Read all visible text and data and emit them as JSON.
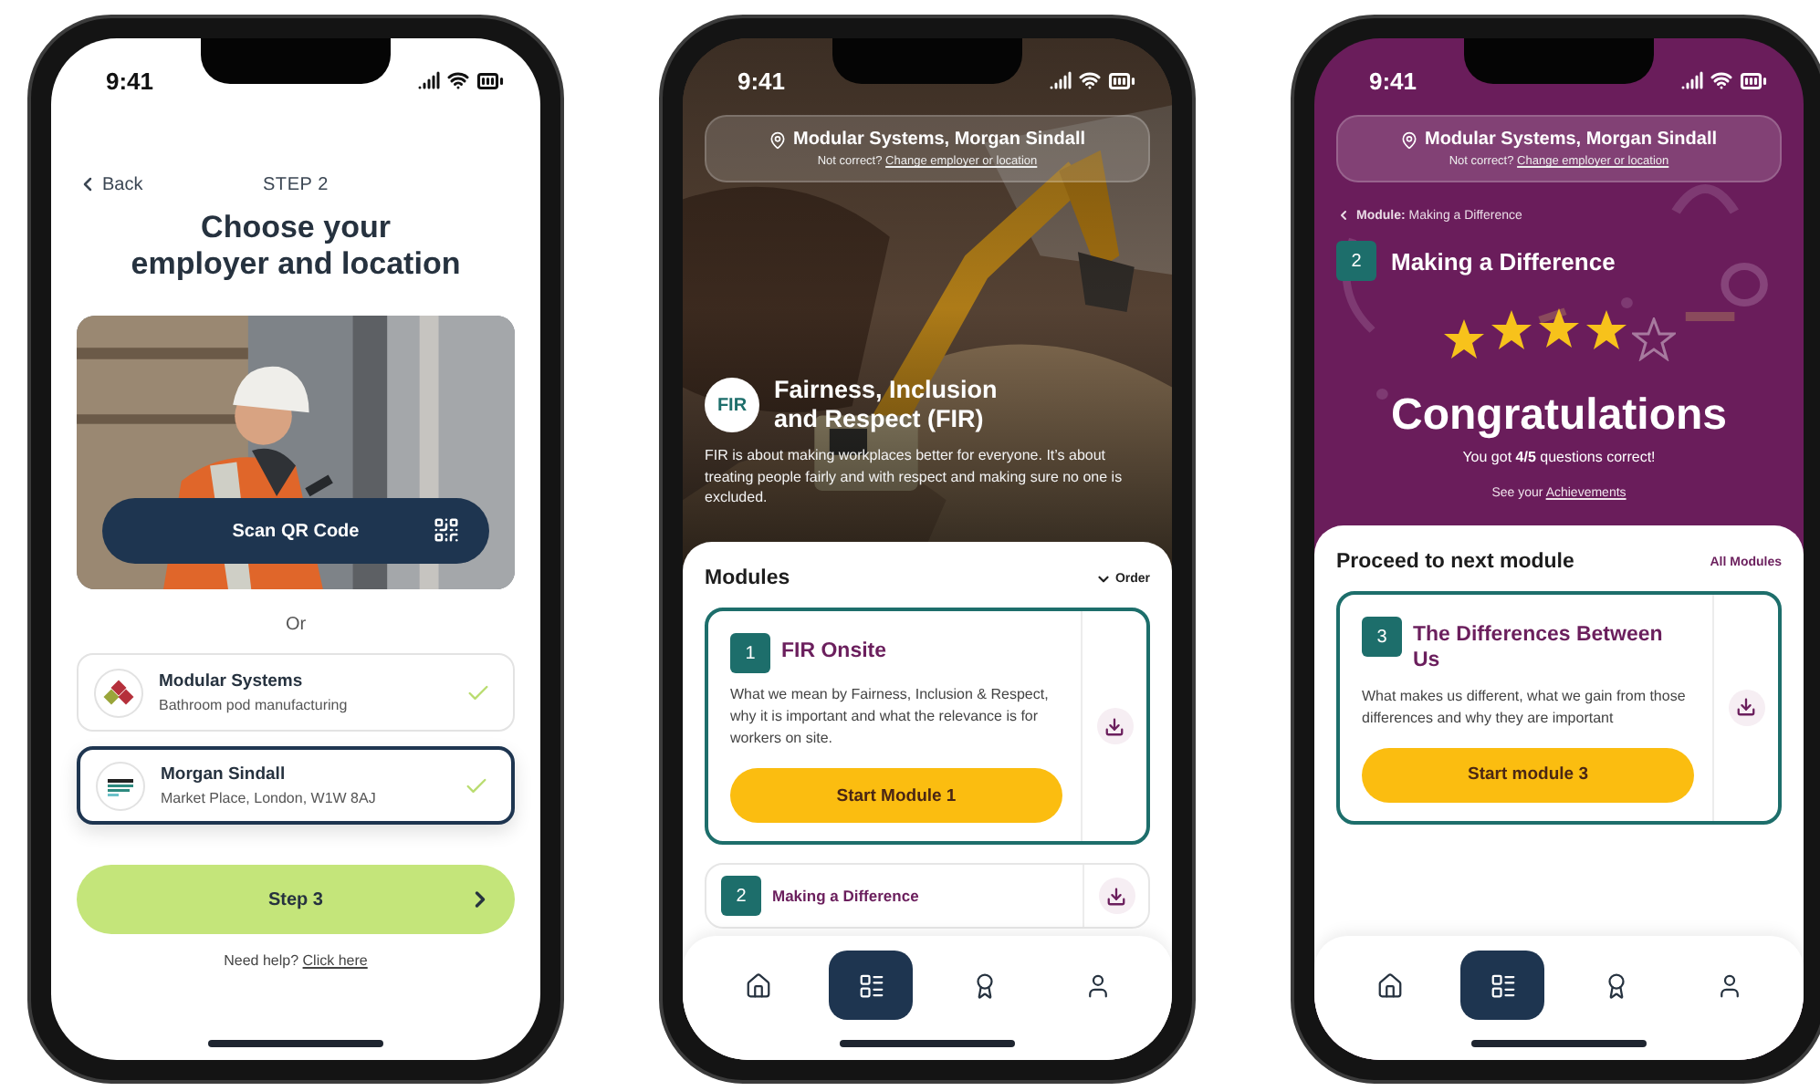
{
  "phones": [
    {
      "kind": "employer_select",
      "time": "9:41",
      "back": "Back",
      "step": "STEP 2",
      "title": "Choose your employer and location",
      "scan_button": "Scan QR Code",
      "divider": "Or",
      "employers": [
        {
          "kind": "modular",
          "name": "Modular Systems",
          "detail": "Bathroom pod manufacturing",
          "selected": false
        },
        {
          "kind": "morgan",
          "name": "Morgan Sindall",
          "detail": "Market Place, London, W1W 8AJ",
          "selected": true
        }
      ],
      "next_button": "Step 3",
      "help": "Need help?",
      "help_link": "Click here"
    },
    {
      "kind": "modules",
      "time": "9:41",
      "location": {
        "name": "Modular Systems, Morgan Sindall",
        "note": "Not correct?",
        "link": "Change employer or location"
      },
      "badge": "FIR",
      "heading": "Fairness, Inclusion and Respect (FIR)",
      "description": "FIR is about making workplaces better for everyone. It’s about treating people fairly and with respect and making sure no one is excluded.",
      "section_title": "Modules",
      "order": "Order",
      "modules": [
        {
          "number": "1",
          "title": "FIR Onsite",
          "description": "What we mean by Fairness, Inclusion & Respect, why it is important and what the relevance is for workers on site.",
          "button": "Start Module 1",
          "selected": true
        },
        {
          "number": "2",
          "title": "Making a Difference",
          "selected": false
        }
      ],
      "nav": [
        {
          "kind": "home",
          "selected": false
        },
        {
          "kind": "modules",
          "selected": true
        },
        {
          "kind": "achievements",
          "selected": false
        },
        {
          "kind": "profile",
          "selected": false
        }
      ]
    },
    {
      "kind": "results",
      "time": "9:41",
      "location": {
        "name": "Modular Systems, Morgan Sindall",
        "note": "Not correct?",
        "link": "Change employer or location"
      },
      "breadcrumb": "**Module:** Making a Difference",
      "module_number": "2",
      "module_title": "Making a Difference",
      "stars": 4,
      "headline": "Congratulations",
      "score": "You got **4/5** questions correct!",
      "achievements_text": "See your",
      "achievements_link": "Achievements",
      "section_title": "Proceed to next module",
      "all_link": "All Modules",
      "modules": [
        {
          "number": "3",
          "title": "The Differences Between Us",
          "description": "What makes us different, what we gain from those differences and why they are important",
          "button": "Start module 3",
          "selected": true
        }
      ],
      "nav": [
        {
          "kind": "home",
          "selected": false
        },
        {
          "kind": "modules",
          "selected": true
        },
        {
          "kind": "achievements",
          "selected": false
        },
        {
          "kind": "profile",
          "selected": false
        }
      ]
    }
  ]
}
